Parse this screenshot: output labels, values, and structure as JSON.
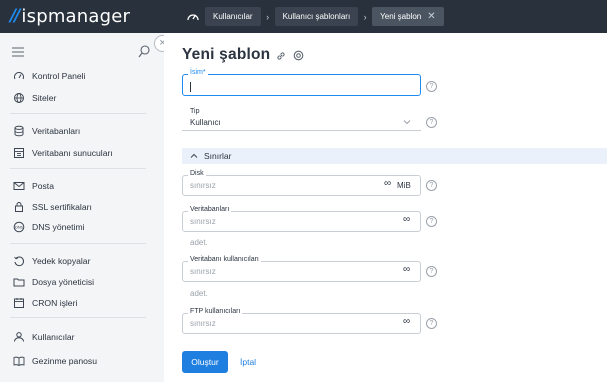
{
  "brand": {
    "mark": "//",
    "name": "ispmanager"
  },
  "breadcrumbs": [
    "Kullanıcılar",
    "Kullanıcı şablonları",
    "Yeni şablon"
  ],
  "sidebar": {
    "items": [
      {
        "label": "Kontrol Paneli",
        "icon": "dashboard-icon"
      },
      {
        "label": "Siteler",
        "icon": "globe-icon"
      },
      {
        "label": "Veritabanları",
        "icon": "database-icon"
      },
      {
        "label": "Veritabanı sunucuları",
        "icon": "db-server-icon"
      },
      {
        "label": "Posta",
        "icon": "mail-icon"
      },
      {
        "label": "SSL sertifikaları",
        "icon": "lock-icon"
      },
      {
        "label": "DNS yönetimi",
        "icon": "dns-icon"
      },
      {
        "label": "Yedek kopyalar",
        "icon": "backup-icon"
      },
      {
        "label": "Dosya yöneticisi",
        "icon": "folder-icon"
      },
      {
        "label": "CRON işleri",
        "icon": "calendar-icon"
      },
      {
        "label": "Kullanıcılar",
        "icon": "user-icon"
      },
      {
        "label": "Gezinme panosu",
        "icon": "book-icon"
      }
    ]
  },
  "main": {
    "title": "Yeni şablon",
    "name_field": {
      "label": "İsim*",
      "value": ""
    },
    "type_field": {
      "label": "Tip",
      "value": "Kullanıcı"
    },
    "section_label": "Sınırlar",
    "disk": {
      "label": "Disk",
      "placeholder": "sınırsız",
      "unit": "MiB"
    },
    "databases": {
      "label": "Veritabanları",
      "placeholder": "sınırsız",
      "unit": "adet."
    },
    "db_users": {
      "label": "Veritabanı kullanıcıları",
      "placeholder": "sınırsız",
      "unit": "adet."
    },
    "ftp_users": {
      "label": "FTP kullanıcıları",
      "placeholder": "sınırsız"
    },
    "infinity_symbol": "∞",
    "help_symbol": "?",
    "submit_label": "Oluştur",
    "cancel_label": "İptal"
  },
  "colors": {
    "accent": "#1e8bf0",
    "topbar": "#29313c",
    "sidebar": "#f4f5f7",
    "section": "#eaf1fb"
  }
}
